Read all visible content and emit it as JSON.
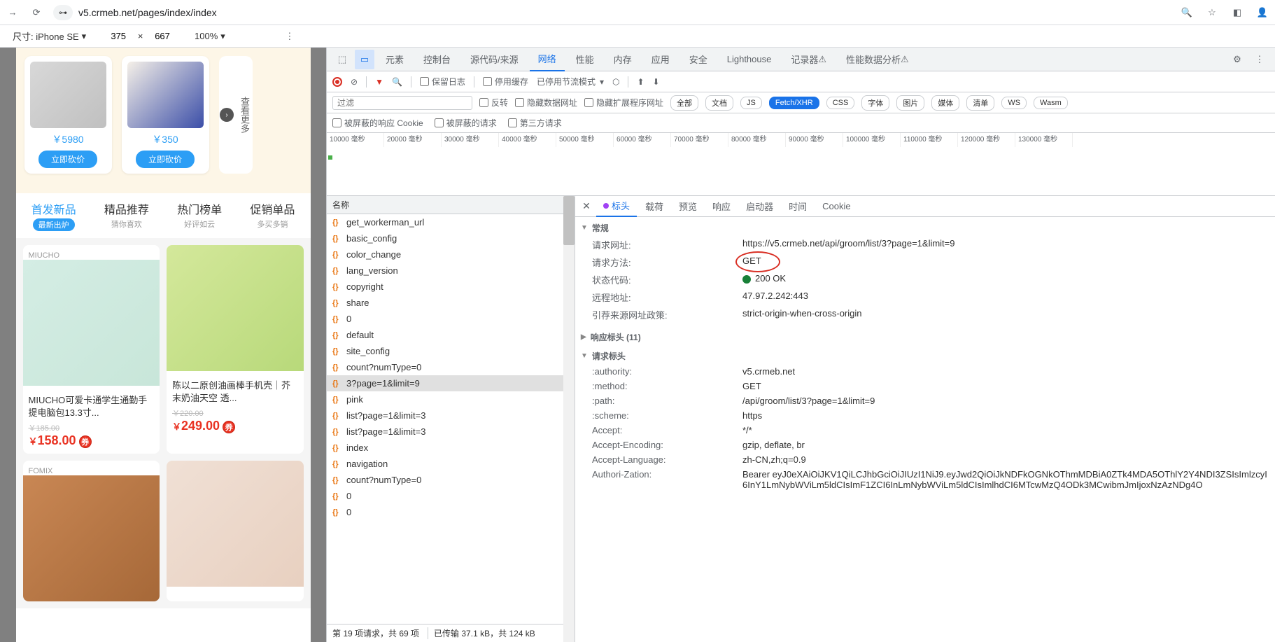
{
  "browser": {
    "url": "v5.crmeb.net/pages/index/index"
  },
  "deviceBar": {
    "label": "尺寸: iPhone SE",
    "width": "375",
    "height": "667",
    "zoom": "100%"
  },
  "mobile": {
    "prod1_price": "￥5980",
    "prod2_price": "￥350",
    "buy_btn": "立即砍价",
    "more": "查看更多",
    "tabs": [
      {
        "title": "首发新品",
        "badge": "最新出炉"
      },
      {
        "title": "精品推荐",
        "sub": "猜你喜欢"
      },
      {
        "title": "热门榜单",
        "sub": "好评如云"
      },
      {
        "title": "促销单品",
        "sub": "多买多销"
      }
    ],
    "grid": [
      {
        "brand": "MIUCHO",
        "title": "MIUCHO可爱卡通学生通勤手提电脑包13.3寸...",
        "old": "￥185.00",
        "price": "158.00"
      },
      {
        "brand": "",
        "title": "陈以二原创油画棒手机壳｜芥末奶油天空 透...",
        "old": "￥220.00",
        "price": "249.00"
      },
      {
        "brand": "FOMIX",
        "title": "",
        "old": "",
        "price": ""
      },
      {
        "brand": "",
        "title": "",
        "old": "",
        "price": ""
      }
    ]
  },
  "devtools": {
    "tabs": [
      "元素",
      "控制台",
      "源代码/来源",
      "网络",
      "性能",
      "内存",
      "应用",
      "安全",
      "Lighthouse",
      "记录器",
      "性能数据分析"
    ],
    "activeTab": "网络",
    "netToolbar": {
      "preserve": "保留日志",
      "disableCache": "停用缓存",
      "throttling": "已停用节流模式"
    },
    "filterRow": {
      "placeholder": "过滤",
      "invert": "反转",
      "hideData": "隐藏数据网址",
      "hideExt": "隐藏扩展程序网址",
      "types": [
        "全部",
        "文档",
        "JS",
        "Fetch/XHR",
        "CSS",
        "字体",
        "图片",
        "媒体",
        "清单",
        "WS",
        "Wasm"
      ],
      "activeType": "Fetch/XHR"
    },
    "cookieRow": {
      "blockedCookie": "被屏蔽的响应 Cookie",
      "blockedReq": "被屏蔽的请求",
      "thirdParty": "第三方请求"
    },
    "timeline": {
      "ticks": [
        "10000 毫秒",
        "20000 毫秒",
        "30000 毫秒",
        "40000 毫秒",
        "50000 毫秒",
        "60000 毫秒",
        "70000 毫秒",
        "80000 毫秒",
        "90000 毫秒",
        "100000 毫秒",
        "110000 毫秒",
        "120000 毫秒",
        "130000 毫秒"
      ]
    },
    "reqList": {
      "header": "名称",
      "items": [
        "get_workerman_url",
        "basic_config",
        "color_change",
        "lang_version",
        "copyright",
        "share",
        "0",
        "default",
        "site_config",
        "count?numType=0",
        "3?page=1&limit=9",
        "pink",
        "list?page=1&limit=3",
        "list?page=1&limit=3",
        "index",
        "navigation",
        "count?numType=0",
        "0",
        "0"
      ],
      "selected": "3?page=1&limit=9",
      "footer": "第 19 项请求，共 69 项",
      "footer2": "已传输 37.1 kB，共 124 kB"
    },
    "detail": {
      "tabs": [
        "标头",
        "载荷",
        "预览",
        "响应",
        "启动器",
        "时间",
        "Cookie"
      ],
      "activeTab": "标头",
      "general": {
        "title": "常规",
        "url_k": "请求网址:",
        "url_v": "https://v5.crmeb.net/api/groom/list/3?page=1&limit=9",
        "method_k": "请求方法:",
        "method_v": "GET",
        "status_k": "状态代码:",
        "status_v": "200 OK",
        "remote_k": "远程地址:",
        "remote_v": "47.97.2.242:443",
        "referrer_k": "引荐来源网址政策:",
        "referrer_v": "strict-origin-when-cross-origin"
      },
      "respHdr": "响应标头 (11)",
      "reqHdr": {
        "title": "请求标头",
        "rows": [
          {
            "k": ":authority:",
            "v": "v5.crmeb.net"
          },
          {
            "k": ":method:",
            "v": "GET"
          },
          {
            "k": ":path:",
            "v": "/api/groom/list/3?page=1&limit=9"
          },
          {
            "k": ":scheme:",
            "v": "https"
          },
          {
            "k": "Accept:",
            "v": "*/*"
          },
          {
            "k": "Accept-Encoding:",
            "v": "gzip, deflate, br"
          },
          {
            "k": "Accept-Language:",
            "v": "zh-CN,zh;q=0.9"
          },
          {
            "k": "Authori-Zation:",
            "v": "Bearer eyJ0eXAiOiJKV1QiLCJhbGciOiJIUzI1NiJ9.eyJwd2QiOiJkNDFkOGNkOThmMDBiA0ZTk4MDA5OThlY2Y4NDI3ZSIsImlzcyI6InY1LmNybWViLm5ldCIsImF1ZCI6InLmNybWViLm5ldCIsImlhdCI6MTcwMzQ4ODk3MCwibmJmIjoxNzAzNDg4O"
          }
        ]
      }
    }
  }
}
